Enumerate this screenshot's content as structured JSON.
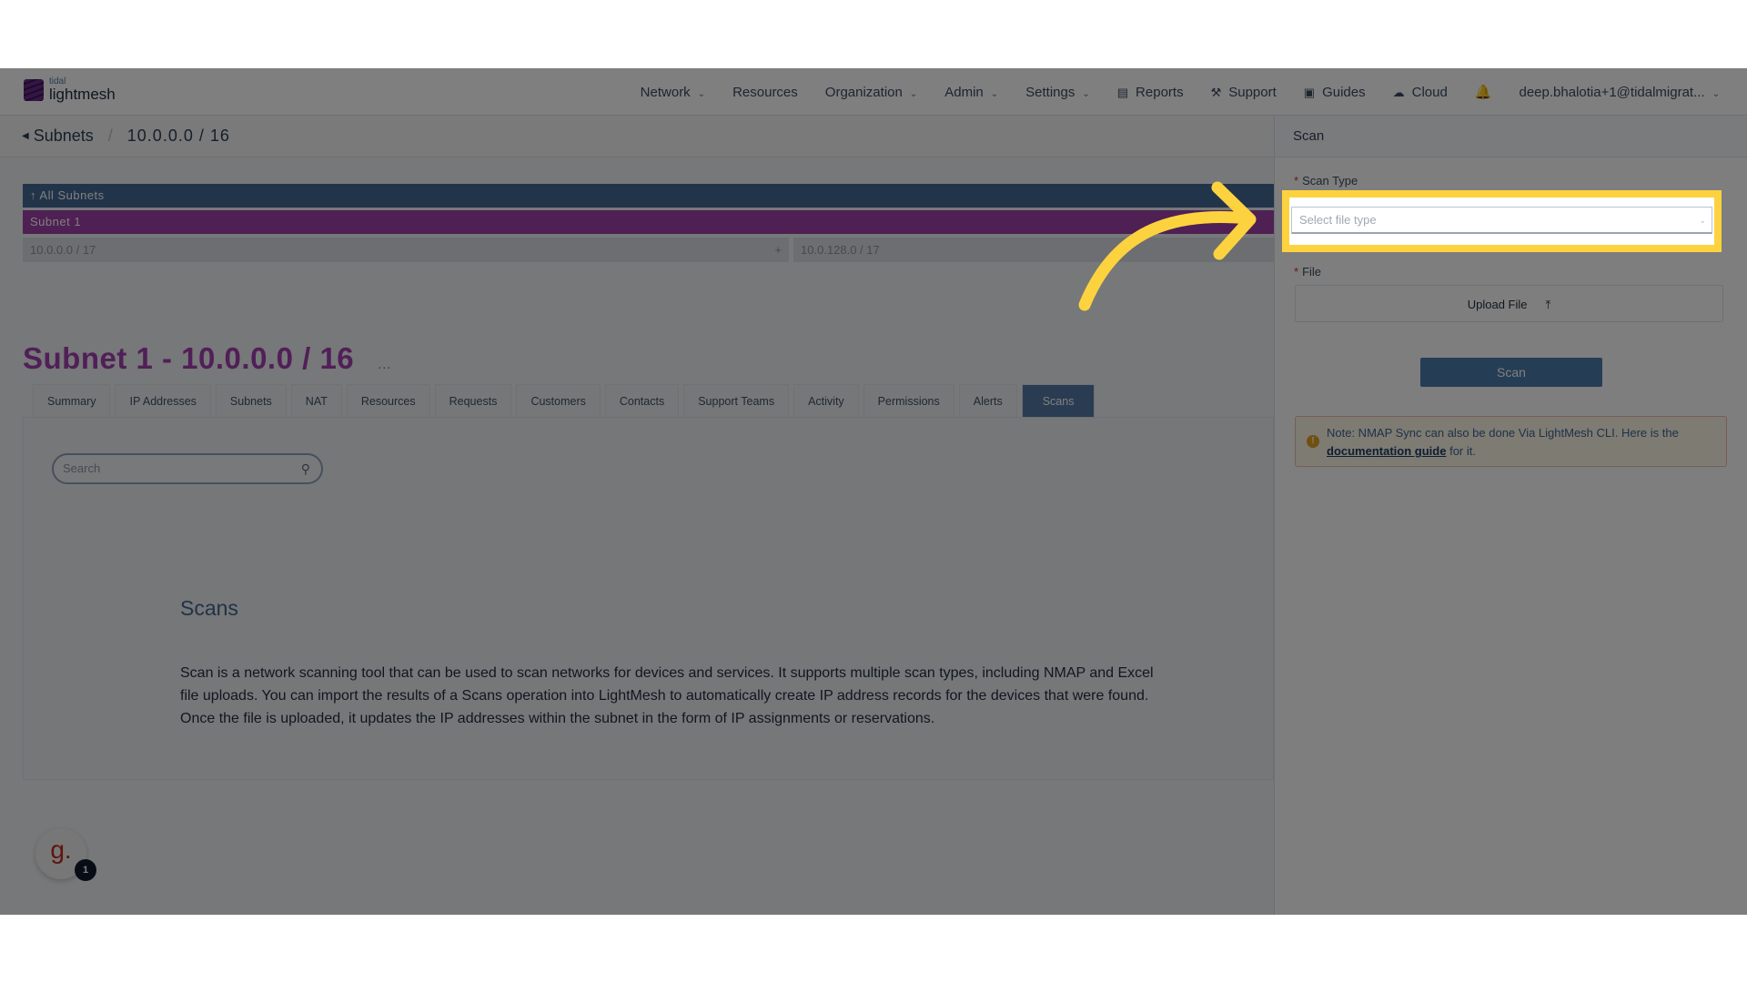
{
  "nav": {
    "logo_top": "tidal",
    "logo_bottom": "lightmesh",
    "items": [
      "Network",
      "Resources",
      "Organization",
      "Admin",
      "Settings",
      "Reports",
      "Support",
      "Guides",
      "Cloud"
    ],
    "user": "deep.bhalotia+1@tidalmigrat..."
  },
  "breadcrumb": {
    "parent": "Subnets",
    "current": "10.0.0.0 / 16"
  },
  "tree": {
    "all": "All Subnets",
    "selected": "Subnet 1",
    "left": "10.0.0.0 / 17",
    "right": "10.0.128.0 / 17",
    "add": "+"
  },
  "page": {
    "title": "Subnet 1 - 10.0.0.0 / 16",
    "more": "...",
    "tabs": [
      "Summary",
      "IP Addresses",
      "Subnets",
      "NAT",
      "Resources",
      "Requests",
      "Customers",
      "Contacts",
      "Support Teams",
      "Activity",
      "Permissions",
      "Alerts",
      "Scans"
    ],
    "search_placeholder": "Search",
    "scans_heading": "Scans",
    "scans_text": "Scan is a network scanning tool that can be used to scan networks for devices and services. It supports multiple scan types, including NMAP and Excel file uploads. You can import the results of a Scans operation into LightMesh to automatically create IP address records for the devices that were found. Once the file is uploaded, it updates the IP addresses within the subnet in the form of IP assignments or reservations."
  },
  "help": {
    "avatar": "g.",
    "badge": "1"
  },
  "panel": {
    "title": "Scan",
    "scan_type_label": "Scan Type",
    "scan_type_placeholder": "Select file type",
    "file_label": "File",
    "upload": "Upload File",
    "scan_button": "Scan",
    "note_prefix": "Note: NMAP Sync can also be done Via LightMesh CLI. Here is the",
    "note_link": "documentation guide",
    "note_suffix": "for it.",
    "required": "*"
  },
  "colors": {
    "highlight": "#fdd23f",
    "accent": "#a33fb0"
  }
}
